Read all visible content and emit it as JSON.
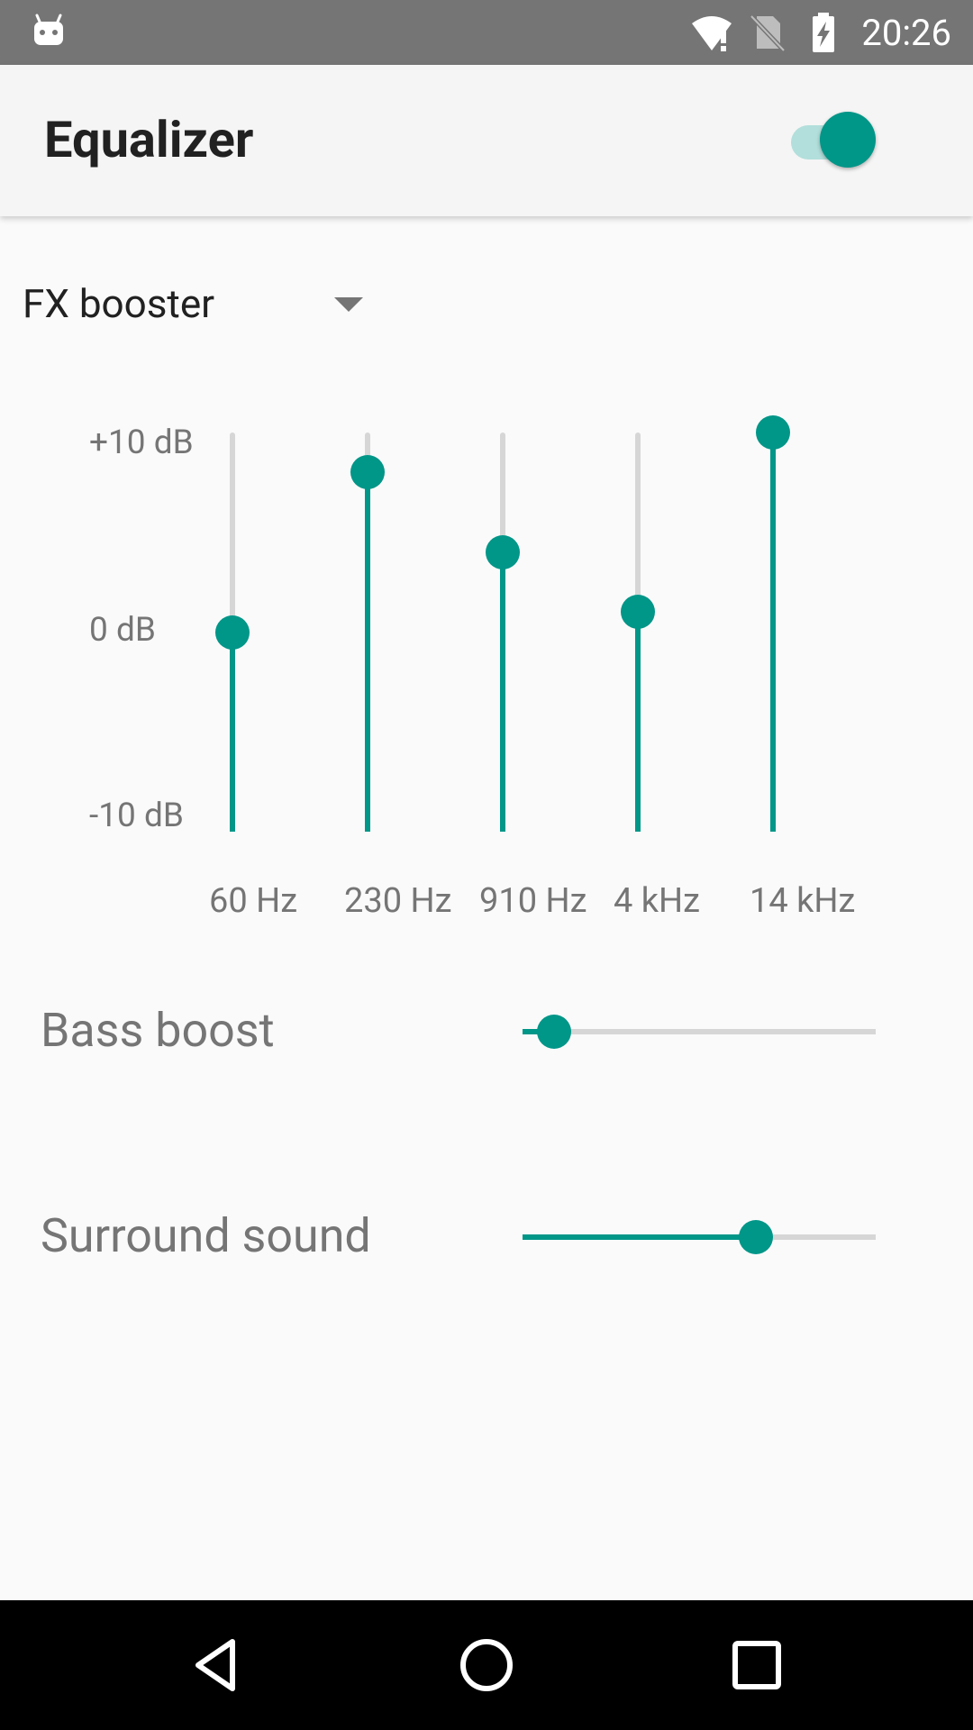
{
  "status_bar": {
    "time": "20:26",
    "icons": [
      "android-icon",
      "wifi-alert-icon",
      "no-sim-icon",
      "battery-charging-icon"
    ]
  },
  "app_bar": {
    "title": "Equalizer",
    "toggle_on": true
  },
  "preset": {
    "label": "FX booster"
  },
  "equalizer": {
    "db_labels": [
      "+10 dB",
      "0 dB",
      "-10 dB"
    ],
    "min_db": -10,
    "max_db": 10,
    "bands": [
      {
        "label": "60 Hz",
        "gain_db": 0
      },
      {
        "label": "230 Hz",
        "gain_db": 8
      },
      {
        "label": "910 Hz",
        "gain_db": 4
      },
      {
        "label": "4 kHz",
        "gain_db": 1
      },
      {
        "label": "14 kHz",
        "gain_db": 10
      }
    ]
  },
  "effects": [
    {
      "label": "Bass boost",
      "value_fraction": 0.09
    },
    {
      "label": "Surround sound",
      "value_fraction": 0.66
    }
  ],
  "colors": {
    "accent": "#009688",
    "accent_light": "#b2dfdb",
    "track": "#d6d6d6",
    "status_bar": "#757575",
    "app_bar": "#f5f5f5",
    "background": "#fafafa",
    "nav_bar": "#000000"
  },
  "nav_bar": {
    "buttons": [
      "back-icon",
      "home-icon",
      "recents-icon"
    ]
  }
}
